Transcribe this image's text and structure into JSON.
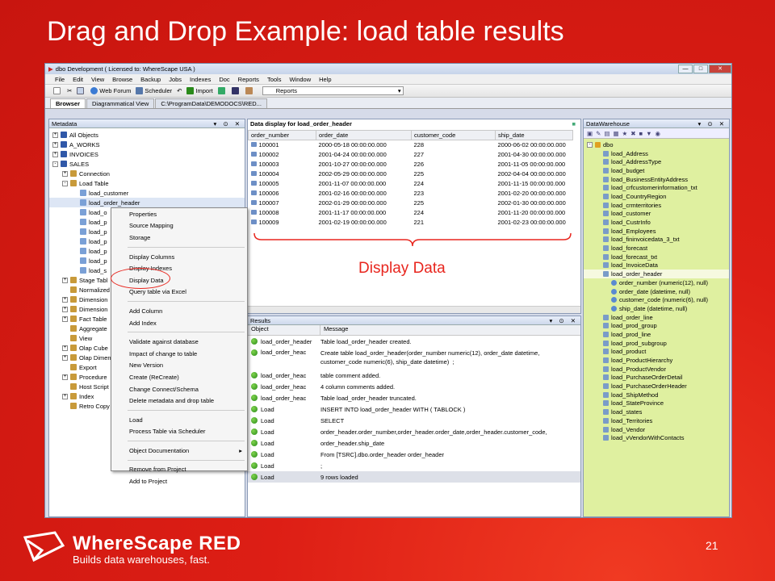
{
  "slide": {
    "title": "Drag and Drop Example: load table results",
    "page_number": "21",
    "brand": "WhereScape RED",
    "tagline": "Builds data warehouses, fast.",
    "callout": "Display Data"
  },
  "window": {
    "title": "dbo  Development  ( Licensed to: WhereScape USA )",
    "menu": [
      "File",
      "Edit",
      "View",
      "Browse",
      "Backup",
      "Jobs",
      "Indexes",
      "Doc",
      "Reports",
      "Tools",
      "Window",
      "Help"
    ],
    "toolbar": {
      "web_forum": "Web Forum",
      "scheduler": "Scheduler",
      "import": "Import",
      "reports": "Reports"
    },
    "tabs": [
      "Browser",
      "Diagrammatical View",
      "C:\\ProgramData\\DEMODOCS\\RED..."
    ]
  },
  "metadata_pane": {
    "title": "Metadata",
    "tree": [
      {
        "label": "All Objects",
        "level": 0,
        "exp": "+"
      },
      {
        "label": "A_WORKS",
        "level": 0,
        "exp": "+"
      },
      {
        "label": "INVOICES",
        "level": 0,
        "exp": "+"
      },
      {
        "label": "SALES",
        "level": 0,
        "exp": "-"
      },
      {
        "label": "Connection",
        "level": 1,
        "exp": "+"
      },
      {
        "label": "Load Table",
        "level": 1,
        "exp": "-"
      },
      {
        "label": "load_customer",
        "level": 2,
        "exp": ""
      },
      {
        "label": "load_order_header",
        "level": 2,
        "exp": ""
      },
      {
        "label": "load_o",
        "level": 2,
        "exp": ""
      },
      {
        "label": "load_p",
        "level": 2,
        "exp": ""
      },
      {
        "label": "load_p",
        "level": 2,
        "exp": ""
      },
      {
        "label": "load_p",
        "level": 2,
        "exp": ""
      },
      {
        "label": "load_p",
        "level": 2,
        "exp": ""
      },
      {
        "label": "load_p",
        "level": 2,
        "exp": ""
      },
      {
        "label": "load_s",
        "level": 2,
        "exp": ""
      },
      {
        "label": "Stage Tabl",
        "level": 1,
        "exp": "+"
      },
      {
        "label": "Normalized",
        "level": 1,
        "exp": ""
      },
      {
        "label": "Dimension",
        "level": 1,
        "exp": "+"
      },
      {
        "label": "Dimension",
        "level": 1,
        "exp": "+"
      },
      {
        "label": "Fact Table",
        "level": 1,
        "exp": "+"
      },
      {
        "label": "Aggregate",
        "level": 1,
        "exp": ""
      },
      {
        "label": "View",
        "level": 1,
        "exp": ""
      },
      {
        "label": "Olap Cube",
        "level": 1,
        "exp": "+"
      },
      {
        "label": "Olap Dimen",
        "level": 1,
        "exp": "+"
      },
      {
        "label": "Export",
        "level": 1,
        "exp": ""
      },
      {
        "label": "Procedure",
        "level": 1,
        "exp": "+"
      },
      {
        "label": "Host Script",
        "level": 1,
        "exp": ""
      },
      {
        "label": "Index",
        "level": 1,
        "exp": "+"
      },
      {
        "label": "Retro Copy",
        "level": 1,
        "exp": ""
      }
    ]
  },
  "context_menu": {
    "items": [
      "Properties",
      "Source Mapping",
      "Storage",
      "-",
      "Display Columns",
      "Display Indexes",
      "Display Data",
      "Query table via Excel",
      "-",
      "Add Column",
      "Add Index",
      "-",
      "Validate against database",
      "Impact of change to table",
      "New Version",
      "Create (ReCreate)",
      "Change Connect/Schema",
      "Delete metadata and drop table",
      "-",
      "Load",
      "Process Table via Scheduler",
      "-",
      "Object Documentation",
      "-",
      "Remove from Project",
      "Add to Project"
    ]
  },
  "data_pane": {
    "title": "Data display for load_order_header",
    "columns": [
      "order_number",
      "order_date",
      "customer_code",
      "ship_date"
    ],
    "rows": [
      [
        "100001",
        "2000-05-18 00:00:00.000",
        "228",
        "2000-06-02 00:00:00.000"
      ],
      [
        "100002",
        "2001-04-24 00:00:00.000",
        "227",
        "2001-04-30 00:00:00.000"
      ],
      [
        "100003",
        "2001-10-27 00:00:00.000",
        "226",
        "2001-11-05 00:00:00.000"
      ],
      [
        "100004",
        "2002-05-29 00:00:00.000",
        "225",
        "2002-04-04 00:00:00.000"
      ],
      [
        "100005",
        "2001-11-07 00:00:00.000",
        "224",
        "2001-11-15 00:00:00.000"
      ],
      [
        "100006",
        "2001-02-16 00:00:00.000",
        "223",
        "2001-02-20 00:00:00.000"
      ],
      [
        "100007",
        "2002-01-29 00:00:00.000",
        "225",
        "2002-01-30 00:00:00.000"
      ],
      [
        "100008",
        "2001-11-17 00:00:00.000",
        "224",
        "2001-11-20 00:00:00.000"
      ],
      [
        "100009",
        "2001-02-19 00:00:00.000",
        "221",
        "2001-02-23 00:00:00.000"
      ]
    ]
  },
  "results_pane": {
    "title": "Results",
    "columns": [
      "Object",
      "Message"
    ],
    "rows": [
      [
        "load_order_header",
        "Table load_order_header created."
      ],
      [
        "load_order_heac",
        "Create table load_order_header(order_number numeric(12), order_date datetime,\ncustomer_code numeric(6), ship_date datetime)  ;"
      ],
      [
        "load_order_heac",
        "table comment added."
      ],
      [
        "load_order_heac",
        "4 column comments added."
      ],
      [
        "load_order_heac",
        "Table load_order_header truncated."
      ],
      [
        "Load",
        "INSERT INTO load_order_header WITH ( TABLOCK )"
      ],
      [
        "Load",
        "SELECT"
      ],
      [
        "Load",
        "order_header.order_number,order_header.order_date,order_header.customer_code,"
      ],
      [
        "Load",
        "order_header.ship_date"
      ],
      [
        "Load",
        "From [TSRC].dbo.order_header order_header"
      ],
      [
        "Load",
        ";"
      ],
      [
        "Load",
        "9 rows loaded"
      ]
    ]
  },
  "warehouse_pane": {
    "title": "DataWarehouse",
    "root": "dbo",
    "tables": [
      "load_Address",
      "load_AddressType",
      "load_budget",
      "load_BusinessEntityAddress",
      "load_crfcustomerinformation_txt",
      "load_CountryRegion",
      "load_crmterritories",
      "load_customer",
      "load_CustrInfo",
      "load_Employees",
      "load_fininvoicedata_3_txt",
      "load_forecast",
      "load_forecast_txt",
      "load_InvoiceData",
      "load_order_header"
    ],
    "columns": [
      "order_number  (numeric(12), null)",
      "order_date  (datetime, null)",
      "customer_code  (numeric(6), null)",
      "ship_date  (datetime, null)"
    ],
    "tables_after": [
      "load_order_line",
      "load_prod_group",
      "load_prod_line",
      "load_prod_subgroup",
      "load_product",
      "load_ProductHierarchy",
      "load_ProductVendor",
      "load_PurchaseOrderDetail",
      "load_PurchaseOrderHeader",
      "load_ShipMethod",
      "load_StateProvince",
      "load_states",
      "load_Territories",
      "load_Vendor",
      "load_vVendorWithContacts"
    ]
  }
}
